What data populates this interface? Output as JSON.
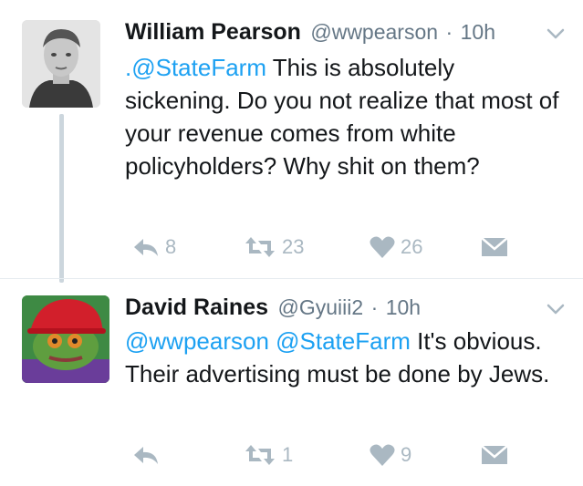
{
  "colors": {
    "link": "#1da1f2",
    "action_gray": "#aab8c2",
    "meta_gray": "#657786",
    "thread_line": "#ccd6dd"
  },
  "tweets": [
    {
      "name": "William Pearson",
      "handle": "@wwpearson",
      "separator": "·",
      "time": "10h",
      "text_mention": ".@StateFarm",
      "text_body": " This is absolutely sickening. Do you not realize that most of your revenue comes from white policyholders? Why shit on them?",
      "replies": "8",
      "retweets": "23",
      "likes": "26",
      "icons": {
        "reply": "reply-icon",
        "retweet": "retweet-icon",
        "like": "heart-icon",
        "dm": "envelope-icon",
        "menu": "chevron-down-icon"
      }
    },
    {
      "name": "David Raines",
      "handle": "@Gyuiii2",
      "separator": "·",
      "time": "10h",
      "text_mention": "@wwpearson @StateFarm",
      "text_body": " It's obvious. Their advertising must be done by Jews.",
      "replies": "",
      "retweets": "1",
      "likes": "9",
      "icons": {
        "reply": "reply-icon",
        "retweet": "retweet-icon",
        "like": "heart-icon",
        "dm": "envelope-icon",
        "menu": "chevron-down-icon"
      }
    }
  ]
}
